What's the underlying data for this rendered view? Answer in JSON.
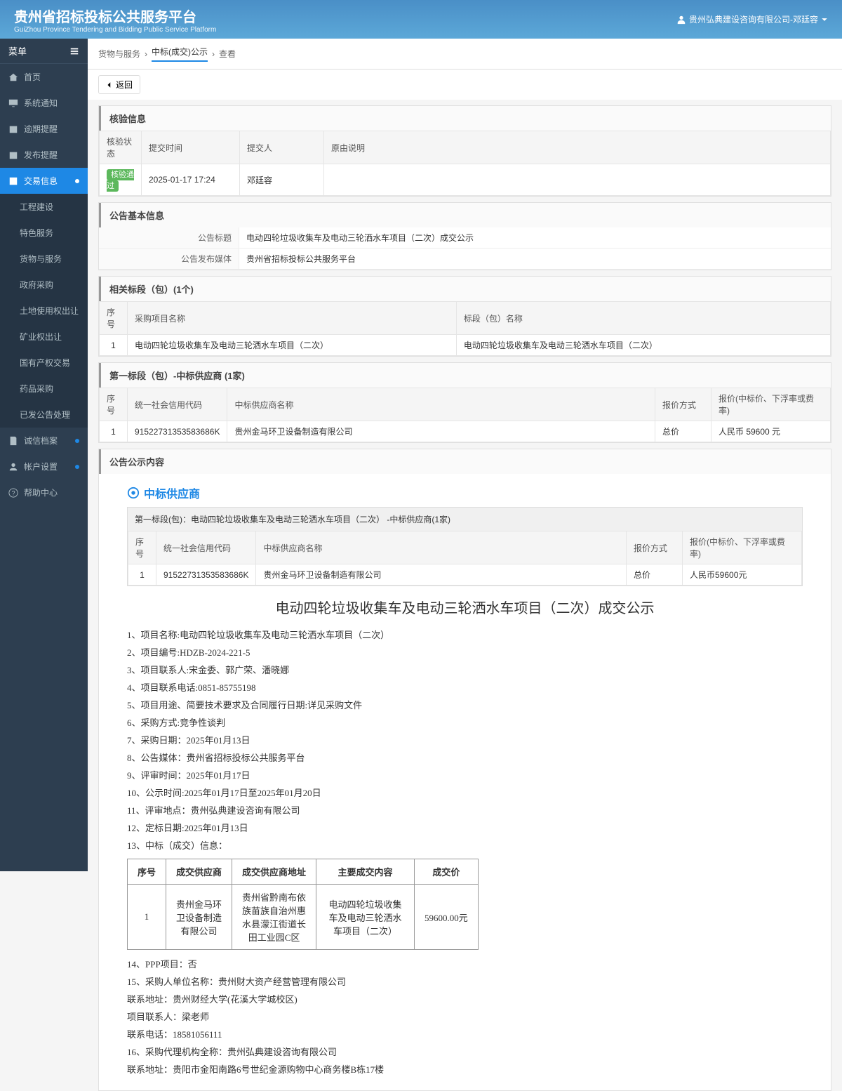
{
  "header": {
    "title": "贵州省招标投标公共服务平台",
    "subtitle": "GuiZhou Province Tendering and Bidding Public Service Platform",
    "user": "贵州弘典建设咨询有限公司-邓廷容"
  },
  "sidebar": {
    "menu_label": "菜单",
    "items": {
      "home": "首页",
      "sys_notice": "系统通知",
      "overdue": "逾期提醒",
      "publish": "发布提醒",
      "trade_info": "交易信息",
      "integrity": "诚信档案",
      "account": "帐户设置",
      "help": "帮助中心"
    },
    "sub_items": {
      "engineering": "工程建设",
      "feature_service": "特色服务",
      "goods_service": "货物与服务",
      "gov_purchase": "政府采购",
      "land_transfer": "土地使用权出让",
      "mining": "矿业权出让",
      "state_assets": "国有产权交易",
      "drug": "药品采购",
      "published": "已发公告处理"
    }
  },
  "breadcrumb": {
    "a": "货物与服务",
    "b": "中标(成交)公示",
    "c": "查看"
  },
  "back_btn": "返回",
  "verify": {
    "title": "核验信息",
    "h_status": "核验状态",
    "h_time": "提交时间",
    "h_person": "提交人",
    "h_reason": "原由说明",
    "status": "核验通过",
    "time": "2025-01-17 17:24",
    "person": "邓廷容",
    "reason": ""
  },
  "basic": {
    "title": "公告基本信息",
    "l_title": "公告标题",
    "v_title": "电动四轮垃圾收集车及电动三轮洒水车项目（二次）成交公示",
    "l_media": "公告发布媒体",
    "v_media": "贵州省招标投标公共服务平台"
  },
  "sections": {
    "title": "相关标段（包）(1个)",
    "h_no": "序号",
    "h_proj": "采购项目名称",
    "h_pkg": "标段（包）名称",
    "no": "1",
    "proj": "电动四轮垃圾收集车及电动三轮洒水车项目（二次）",
    "pkg": "电动四轮垃圾收集车及电动三轮洒水车项目（二次）"
  },
  "winner": {
    "title": "第一标段（包）-中标供应商 (1家)",
    "h_no": "序号",
    "h_code": "统一社会信用代码",
    "h_name": "中标供应商名称",
    "h_method": "报价方式",
    "h_price": "报价(中标价、下浮率或费率)",
    "no": "1",
    "code": "91522731353583686K",
    "name": "贵州金马环卫设备制造有限公司",
    "method": "总价",
    "price": "人民币 59600 元"
  },
  "content_title": "公告公示内容",
  "supplier_hd": "中标供应商",
  "box_title": "第一标段(包)：电动四轮垃圾收集车及电动三轮洒水车项目（二次） -中标供应商(1家)",
  "box": {
    "h_no": "序号",
    "h_code": "统一社会信用代码",
    "h_name": "中标供应商名称",
    "h_method": "报价方式",
    "h_price": "报价(中标价、下浮率或费率)",
    "no": "1",
    "code": "91522731353583686K",
    "name": "贵州金马环卫设备制造有限公司",
    "method": "总价",
    "price": "人民币59600元"
  },
  "announce": {
    "title": "电动四轮垃圾收集车及电动三轮洒水车项目（二次）成交公示",
    "p1": "1、项目名称:电动四轮垃圾收集车及电动三轮洒水车项目（二次）",
    "p2": "2、项目编号:HDZB-2024-221-5",
    "p3": "3、项目联系人:宋金委、郭广荣、潘晓娜",
    "p4": "4、项目联系电话:0851-85755198",
    "p5": "5、项目用途、简要技术要求及合同履行日期:详见采购文件",
    "p6": "6、采购方式:竞争性谈判",
    "p7": "7、采购日期：2025年01月13日",
    "p8": "8、公告媒体：贵州省招标投标公共服务平台",
    "p9": "9、评审时间：2025年01月17日",
    "p10": "10、公示时间:2025年01月17日至2025年01月20日",
    "p11": "11、评审地点：贵州弘典建设咨询有限公司",
    "p12": "12、定标日期:2025年01月13日",
    "p13": "13、中标（成交）信息：",
    "p14": "14、PPP项目：否",
    "p15": "15、采购人单位名称：贵州财大资产经营管理有限公司",
    "p15a": "联系地址：贵州财经大学(花溪大学城校区)",
    "p15b": "项目联系人：梁老师",
    "p15c": "联系电话：18581056111",
    "p16": "16、采购代理机构全称：贵州弘典建设咨询有限公司",
    "p16a": "联系地址：贵阳市金阳南路6号世纪金源购物中心商务楼B栋17楼"
  },
  "deal": {
    "h_no": "序号",
    "h_supplier": "成交供应商",
    "h_addr": "成交供应商地址",
    "h_content": "主要成交内容",
    "h_price": "成交价",
    "no": "1",
    "supplier": "贵州金马环卫设备制造有限公司",
    "addr": "贵州省黔南布依族苗族自治州惠水县濛江街道长田工业园C区",
    "content": "电动四轮垃圾收集车及电动三轮洒水车项目（二次）",
    "price": "59600.00元"
  }
}
